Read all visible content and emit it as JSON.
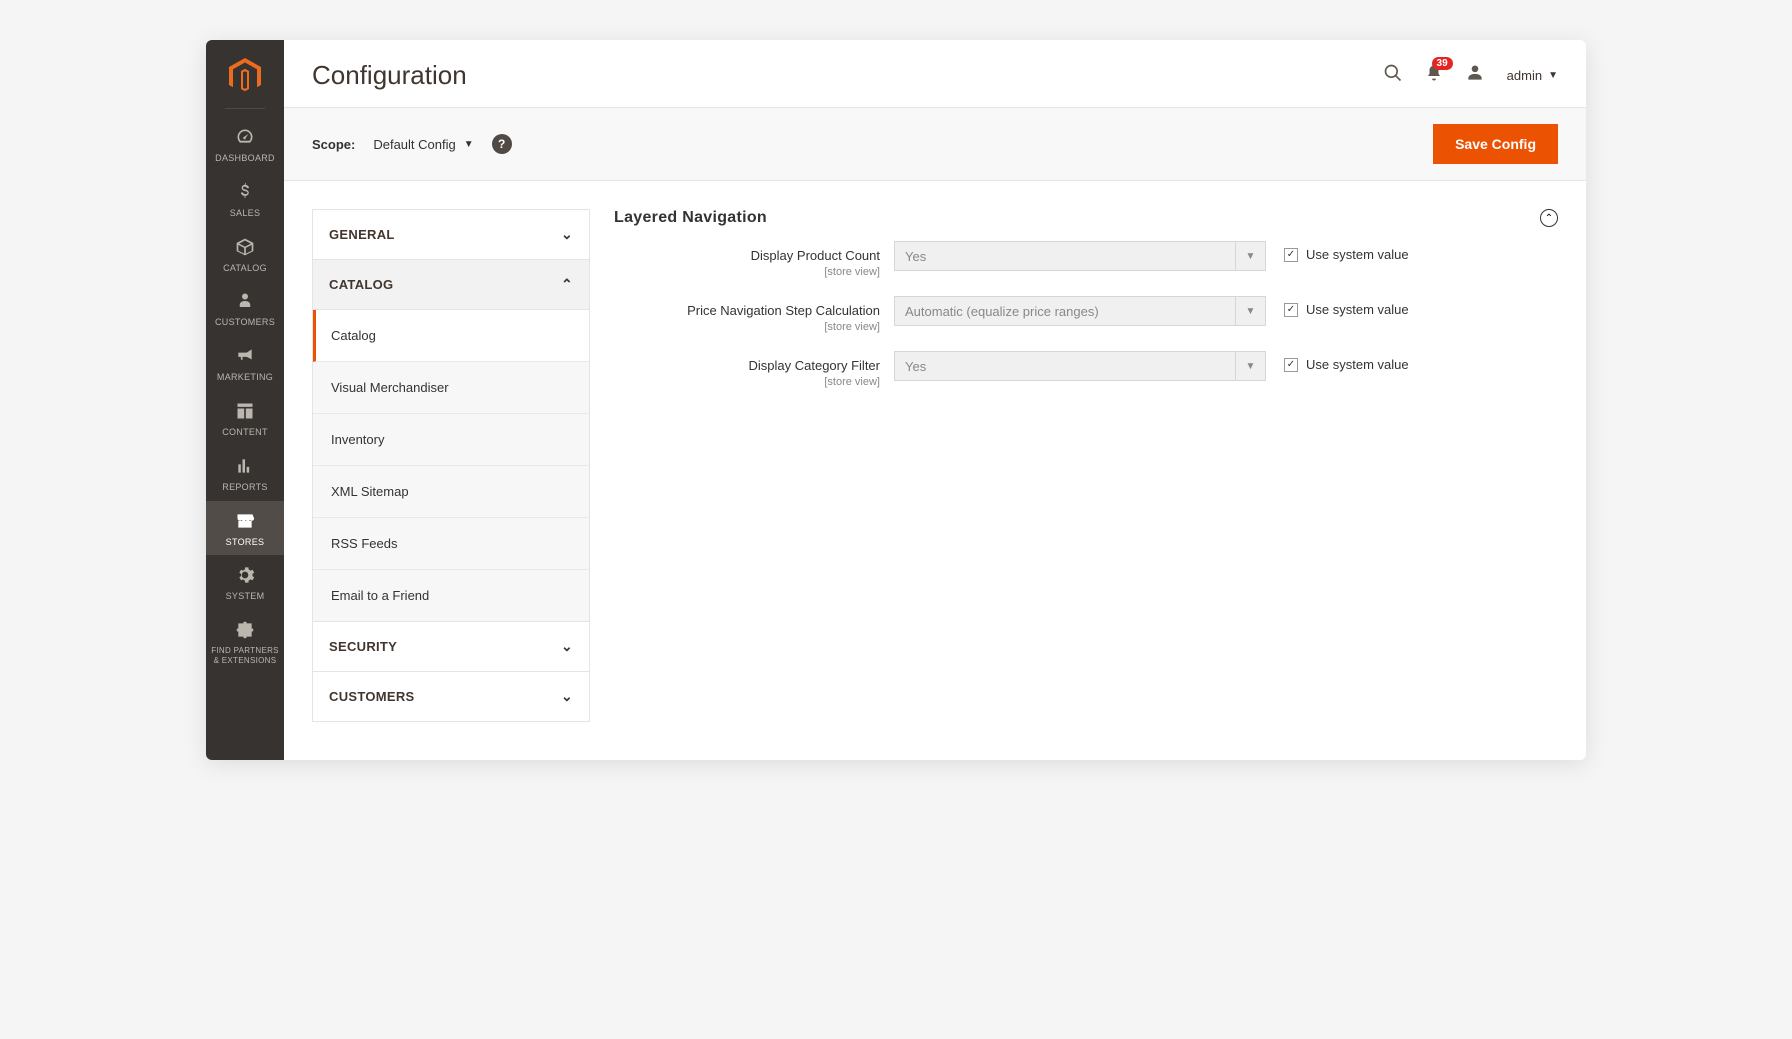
{
  "page_title": "Configuration",
  "notifications_count": "39",
  "user_name": "admin",
  "scope": {
    "label": "Scope:",
    "value": "Default Config"
  },
  "save_button": "Save Config",
  "nav": [
    {
      "label": "DASHBOARD"
    },
    {
      "label": "SALES"
    },
    {
      "label": "CATALOG"
    },
    {
      "label": "CUSTOMERS"
    },
    {
      "label": "MARKETING"
    },
    {
      "label": "CONTENT"
    },
    {
      "label": "REPORTS"
    },
    {
      "label": "STORES"
    },
    {
      "label": "SYSTEM"
    },
    {
      "label": "FIND PARTNERS\n& EXTENSIONS"
    }
  ],
  "sidebar": {
    "sections": [
      {
        "label": "GENERAL",
        "expanded": false
      },
      {
        "label": "CATALOG",
        "expanded": true,
        "items": [
          {
            "label": "Catalog",
            "active": true
          },
          {
            "label": "Visual Merchandiser"
          },
          {
            "label": "Inventory"
          },
          {
            "label": "XML Sitemap"
          },
          {
            "label": "RSS Feeds"
          },
          {
            "label": "Email to a Friend"
          }
        ]
      },
      {
        "label": "SECURITY",
        "expanded": false
      },
      {
        "label": "CUSTOMERS",
        "expanded": false
      }
    ]
  },
  "panel": {
    "title": "Layered Navigation",
    "use_system_label": "Use system value",
    "scope_hint": "[store view]",
    "fields": [
      {
        "label": "Display Product Count",
        "value": "Yes",
        "use_system": true
      },
      {
        "label": "Price Navigation Step Calculation",
        "value": "Automatic (equalize price ranges)",
        "use_system": true
      },
      {
        "label": "Display Category Filter",
        "value": "Yes",
        "use_system": true
      }
    ]
  }
}
